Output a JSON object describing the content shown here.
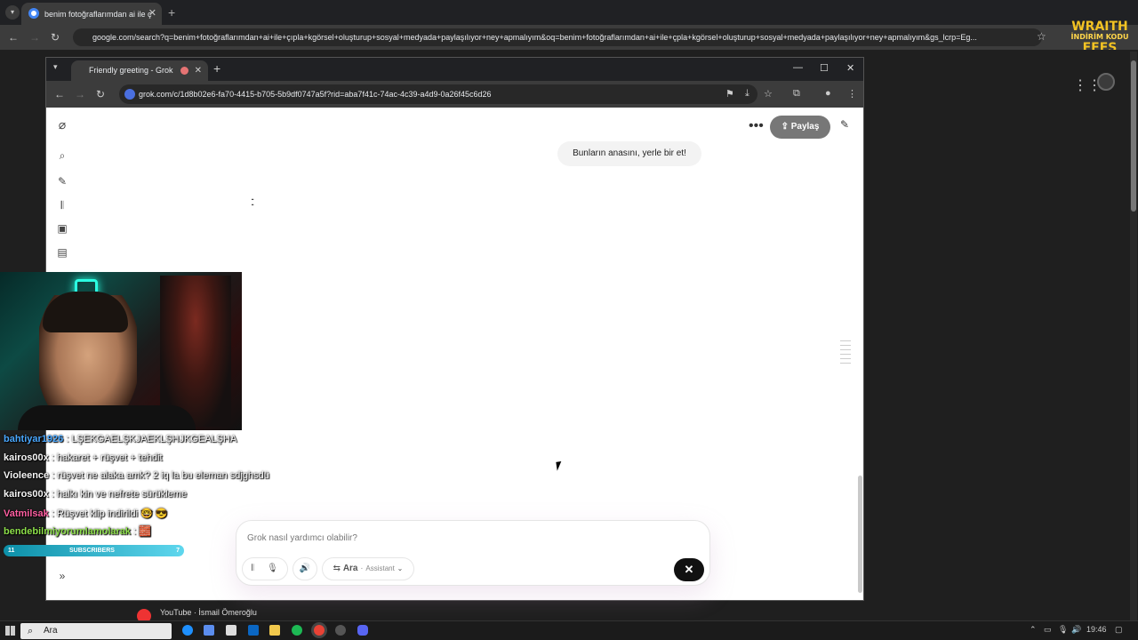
{
  "outer_browser": {
    "tab_title": "benim fotoğraflarımdan ai ile ç",
    "address": "google.com/search?q=benim+fotoğraflarımdan+ai+ile+çıpla+kgörsel+oluşturup+sosyal+medyada+paylaşılıyor+ney+apmalıyım&oq=benim+fotoğraflarımdan+ai+ile+çpla+kgörsel+oluşturup+sosyal+medyada+paylaşılıyor+ney+apmalıyım&gs_lcrp=Eg..."
  },
  "overlay": {
    "wraith_title": "WRAITH",
    "wraith_sub": "İNDİRİM KODU",
    "wraith_code": "EFES"
  },
  "inner_browser": {
    "tab_title": "Friendly greeting - Grok",
    "address": "grok.com/c/1d8b02e6-fa70-4415-b705-5b9df0747a5f?rid=aba7f41c-74ac-4c39-a4d9-0a26f45c6d26"
  },
  "grok": {
    "share_label": "Paylaş",
    "user_message": "Bunların anasını, yerle bir et!",
    "composer_placeholder": "Grok nasıl yardımcı olabilir?",
    "mode_label": "Ara",
    "assistant_label": "Assistant"
  },
  "chat": [
    {
      "user": "bahtiyar1926",
      "color": "#4aa8ff",
      "message": ": LŞEKGAELŞKJAEKLŞHJKGEALŞHA"
    },
    {
      "user": "kairos00x",
      "color": "#ffffff",
      "message": ": hakaret + rüşvet + tehdit"
    },
    {
      "user": "Violeence",
      "color": "#ffffff",
      "message": ": rüşvet ne alaka amk? 2 iq la bu eleman sdjghsdü"
    },
    {
      "user": "kairos00x",
      "color": "#ffffff",
      "message": ": halkı kin ve nefrete sürüklemе"
    },
    {
      "user": "Vatmilsak",
      "color": "#ff5fa2",
      "message": ": Rüşvet klip indirildi 🤓 😎"
    },
    {
      "user": "bendebilmiyorumlamolarak",
      "color": "#8de04a",
      "message": ": 🧱"
    }
  ],
  "subs_bar": {
    "count": "11",
    "label": "SUBSCRIBERS",
    "goal": "7"
  },
  "notification": {
    "text": "YouTube · İsmail Ömeroğlu"
  },
  "taskbar": {
    "search_label": "Ara",
    "time": "19:46"
  },
  "colors": {
    "accent_share": "#777777",
    "send_button": "#111111"
  }
}
